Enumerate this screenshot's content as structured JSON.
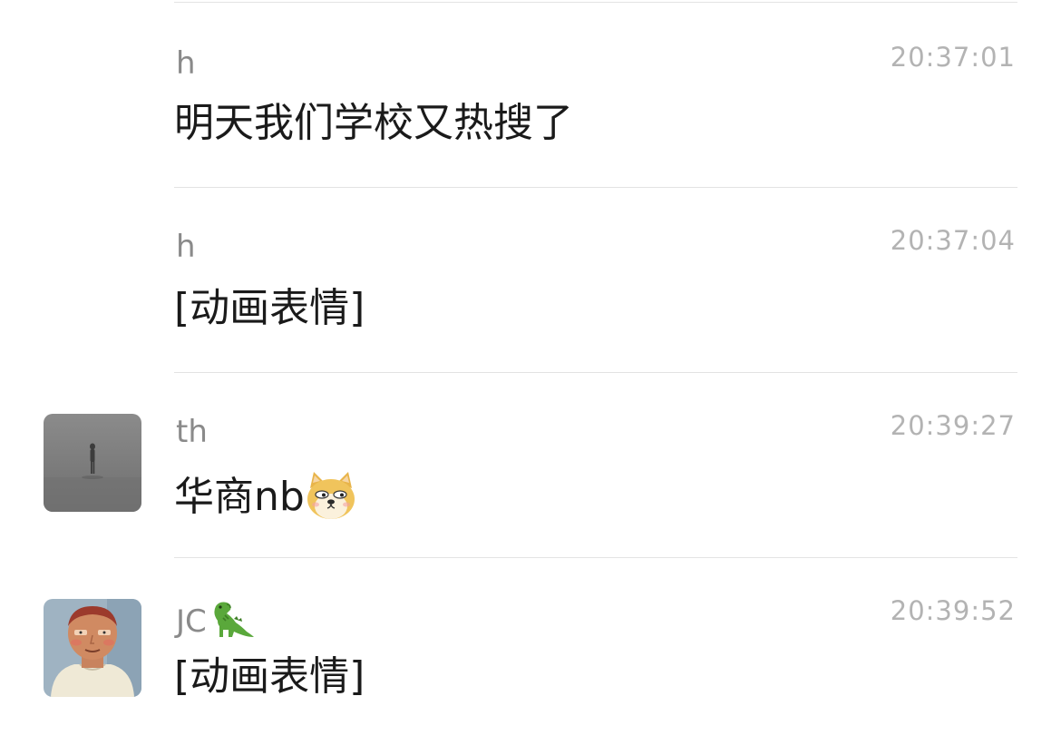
{
  "messages": [
    {
      "sender": "h",
      "time": "20:37:01",
      "text": "明天我们学校又热搜了",
      "has_avatar": false
    },
    {
      "sender": "h",
      "time": "20:37:04",
      "text": "[动画表情]",
      "has_avatar": false
    },
    {
      "sender": "th",
      "time": "20:39:27",
      "text": "华商nb",
      "emoji": "doge-emoji",
      "has_avatar": true,
      "avatar": "misty-figure-avatar"
    },
    {
      "sender": "JC",
      "sender_emoji": "dinosaur-emoji",
      "time": "20:39:52",
      "text": "[动画表情]",
      "has_avatar": true,
      "avatar": "cartoon-man-avatar"
    }
  ],
  "colors": {
    "background": "#ffffff",
    "sender": "#8a8a8a",
    "time": "#b3b3b3",
    "text": "#1a1a1a",
    "divider": "#e3e3e3"
  }
}
